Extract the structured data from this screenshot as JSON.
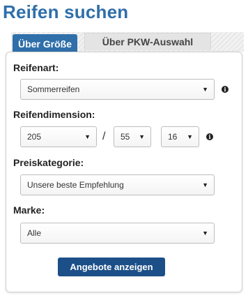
{
  "title": "Reifen suchen",
  "tabs": [
    {
      "label": "Über Größe",
      "active": true
    },
    {
      "label": "Über PKW-Auswahl",
      "active": false
    }
  ],
  "form": {
    "tire_type": {
      "label": "Reifenart:",
      "value": "Sommerreifen"
    },
    "dimension": {
      "label": "Reifendimension:",
      "width": "205",
      "separator": "/",
      "height": "55",
      "diameter": "16"
    },
    "price_category": {
      "label": "Preiskategorie:",
      "value": "Unsere beste Empfehlung"
    },
    "brand": {
      "label": "Marke:",
      "value": "Alle"
    },
    "submit_label": "Angebote anzeigen"
  },
  "icons": {
    "info": "info-icon",
    "dropdown": "chevron-down-icon"
  },
  "colors": {
    "brand_blue": "#2f6faa",
    "button_blue": "#1c4f87"
  }
}
